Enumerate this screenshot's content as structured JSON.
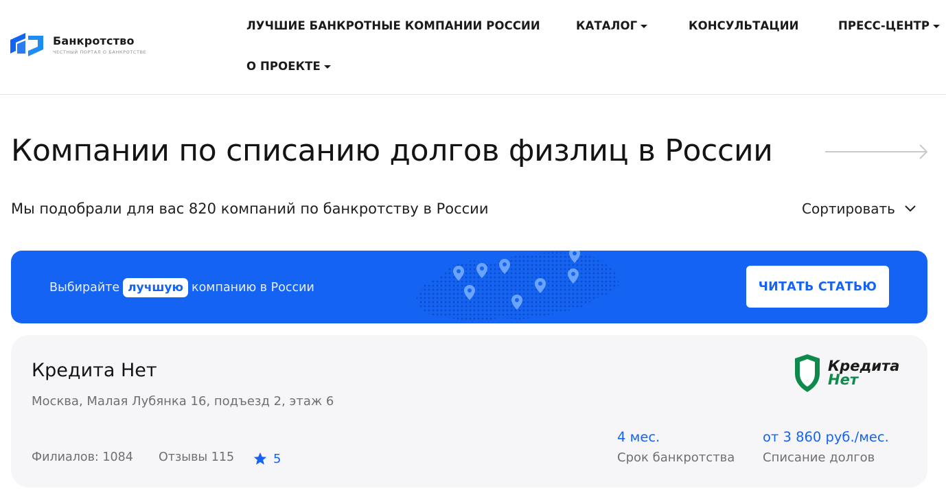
{
  "logo": {
    "title": "Банкротство",
    "subtitle": "честный портал о банкротстве"
  },
  "nav": {
    "best": "ЛУЧШИЕ БАНКРОТНЫЕ КОМПАНИИ РОССИИ",
    "catalog": "КАТАЛОГ",
    "consult": "КОНСУЛЬТАЦИИ",
    "press": "ПРЕСС-ЦЕНТР",
    "about": "О ПРОЕКТЕ"
  },
  "page": {
    "title": "Компании по списанию долгов физлиц в России",
    "subtitle": "Мы подобрали для вас 820 компаний по банкротству в России",
    "sort_label": "Сортировать"
  },
  "banner": {
    "text_before": "Выбирайте",
    "highlight": "лучшую",
    "text_after": "компанию в России",
    "button": "ЧИТАТЬ СТАТЬЮ"
  },
  "company": {
    "name": "Кредита Нет",
    "address": "Москва, Малая Лубянка 16, подъезд 2, этаж 6",
    "branches": "Филиалов: 1084",
    "reviews": "Отзывы 115",
    "rating": "5",
    "term_value": "4 мес.",
    "term_label": "Срок банкротства",
    "price_value": "от 3 860 руб./мес.",
    "price_label": "Списание долгов",
    "logo_line1": "Кредита",
    "logo_line2": "Нет"
  },
  "colors": {
    "accent": "#1463f3",
    "logo_green": "#0f8a4d"
  }
}
